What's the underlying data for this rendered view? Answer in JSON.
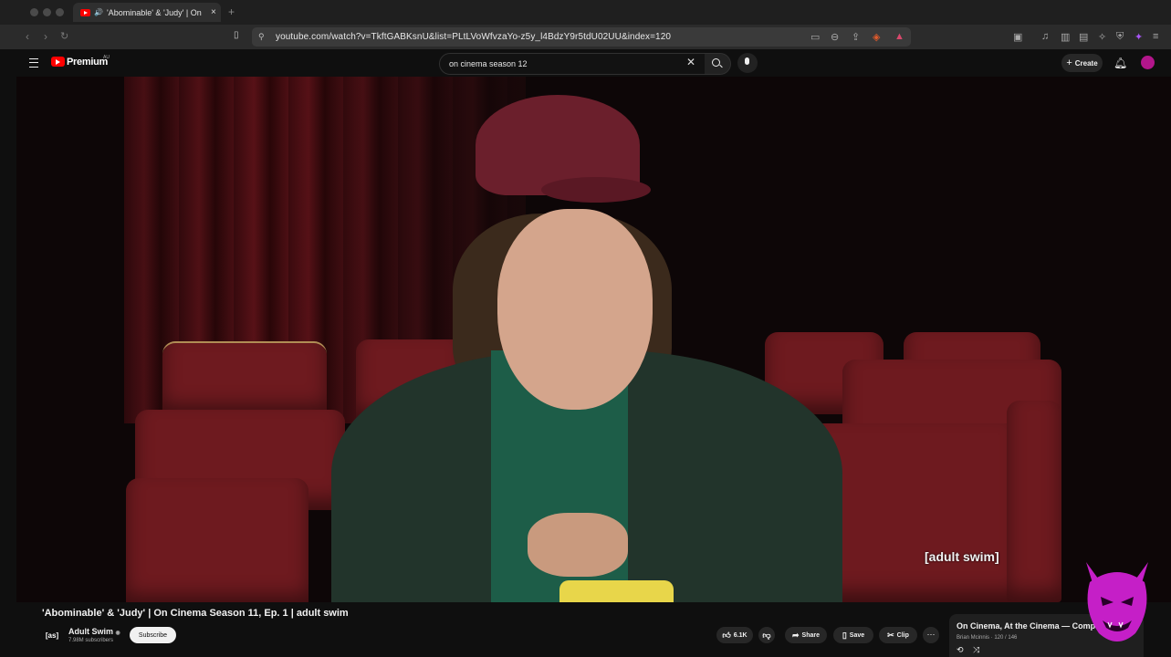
{
  "browser": {
    "tab_title": "'Abominable' & 'Judy' | On",
    "tab_close": "×",
    "new_tab": "+",
    "url": "youtube.com/watch?v=TkftGABKsnU&list=PLtLVoWfvzaYo-z5y_l4BdzY9r5tdU02UU&index=120"
  },
  "youtube": {
    "logo_text": "Premium",
    "region": "AU",
    "search_value": "on cinema season 12",
    "create_label": "Create"
  },
  "video": {
    "watermark": "[adult swim]",
    "title": "'Abominable' & 'Judy' | On Cinema Season 11, Ep. 1 | adult swim",
    "channel": {
      "icon_text": "[as]",
      "name": "Adult Swim",
      "subscribers": "7.98M subscribers",
      "subscribe_label": "Subscribe"
    },
    "actions": {
      "likes": "6.1K",
      "share": "Share",
      "save": "Save",
      "clip": "Clip",
      "more": "⋯"
    }
  },
  "playlist": {
    "title": "On Cinema, At the Cinema — Comple…",
    "subtitle": "Brian Mcinnis · 120 / 146",
    "close": "✕"
  },
  "icons": [
    "back-icon",
    "forward-icon",
    "reload-icon",
    "bookmark-icon",
    "site-info-icon",
    "cast-icon",
    "zoom-icon",
    "share-icon",
    "brave-shield-icon",
    "extension-icon",
    "menu-icon",
    "youtube-logo-icon",
    "clear-icon",
    "search-icon",
    "mic-icon",
    "plus-icon",
    "bell-icon",
    "avatar-icon",
    "like-icon",
    "dislike-icon",
    "share-arrow-icon",
    "save-icon",
    "scissors-icon",
    "loop-icon",
    "shuffle-icon",
    "devil-mascot-icon"
  ],
  "colors": {
    "accent": "#ff0000",
    "background": "#0f0f0f",
    "chrome": "#2b2b2b",
    "mascot": "#c51fc7"
  }
}
